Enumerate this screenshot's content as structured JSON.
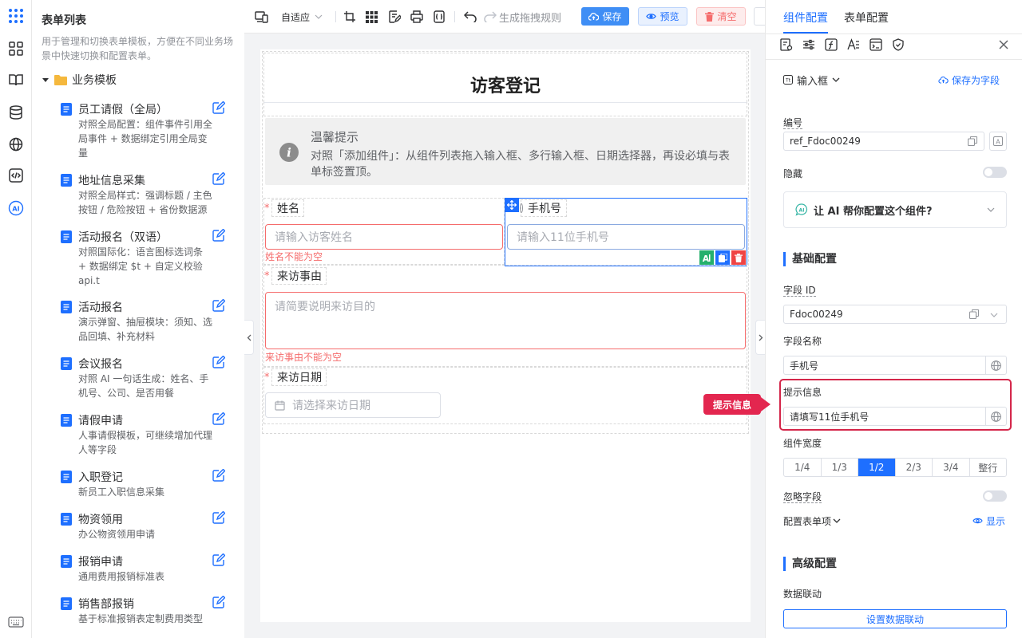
{
  "left_rail": {
    "icons": [
      "apps-grid-icon",
      "widgets-icon",
      "book-icon",
      "database-icon",
      "globe-icon",
      "code-icon",
      "ai-icon",
      "keyboard-icon"
    ]
  },
  "form_list": {
    "title": "表单列表",
    "description": "用于管理和切换表单模板，方便在不同业务场景中快速切换和配置表单。",
    "group": "业务模板",
    "items": [
      {
        "name": "员工请假（全局）",
        "desc": "对照全局配置：组件事件引用全局事件 + 数据绑定引用全局变量"
      },
      {
        "name": "地址信息采集",
        "desc": "对照全局样式：强调标题 / 主色按钮 / 危险按钮 + 省份数据源"
      },
      {
        "name": "活动报名（双语）",
        "desc": "对照国际化：语言图标选词条 + 数据绑定 $t + 自定义校验 api.t"
      },
      {
        "name": "活动报名",
        "desc": "演示弹窗、抽屉模块：须知、选品回填、补充材料"
      },
      {
        "name": "会议报名",
        "desc": "对照 AI 一句话生成：姓名、手机号、公司、是否用餐"
      },
      {
        "name": "请假申请",
        "desc": "人事请假模板，可继续增加代理人等字段"
      },
      {
        "name": "入职登记",
        "desc": "新员工入职信息采集"
      },
      {
        "name": "物资领用",
        "desc": "办公物资领用申请"
      },
      {
        "name": "报销申请",
        "desc": "通用费用报销标准表"
      },
      {
        "name": "销售部报销",
        "desc": "基于标准报销表定制费用类型"
      }
    ]
  },
  "toolbar": {
    "layout_select": "自适应",
    "redo_rules": "生成拖拽规则",
    "save": "保存",
    "preview": "预览",
    "clear": "清空"
  },
  "form": {
    "title": "访客登记",
    "tip_title": "温馨提示",
    "tip_text": "对照「添加组件」：从组件列表拖入输入框、多行输入框、日期选择器，再设必填与表单标签置顶。",
    "fields": [
      {
        "label": "姓名",
        "placeholder": "请输入访客姓名",
        "error": "姓名不能为空"
      },
      {
        "label": "手机号",
        "placeholder": "请输入11位手机号"
      },
      {
        "label": "来访事由",
        "placeholder": "请简要说明来访目的",
        "error": "来访事由不能为空"
      },
      {
        "label": "来访日期",
        "placeholder": "请选择来访日期"
      }
    ],
    "required_mark": "*",
    "field_tools": [
      "ai-icon",
      "copy-icon",
      "delete-icon"
    ]
  },
  "panel": {
    "tabs": [
      "组件配置",
      "表单配置"
    ],
    "component_type": "输入框",
    "save_as_field": "保存为字段",
    "number_label": "编号",
    "number_value": "ref_Fdoc00249",
    "hidden_label": "隐藏",
    "ai_prompt": "让 AI 帮你配置这个组件?",
    "basic_section": "基础配置",
    "field_id_label": "字段 ID",
    "field_id_value": "Fdoc00249",
    "field_name_label": "字段名称",
    "field_name_value": "手机号",
    "hint_label": "提示信息",
    "hint_value": "请填写11位手机号",
    "callout": "提示信息",
    "width_label": "组件宽度",
    "width_options": [
      "1/4",
      "1/3",
      "1/2",
      "2/3",
      "3/4",
      "整行"
    ],
    "width_selected": "1/2",
    "ignore_label": "忽略字段",
    "config_items_label": "配置表单项",
    "show_label": "显示",
    "advanced_section": "高级配置",
    "linkage_label": "数据联动",
    "linkage_button": "设置数据联动"
  },
  "colors": {
    "primary": "#1e6fff",
    "danger": "#f56c6c",
    "highlight": "#d4264a",
    "callout": "#e3264f"
  }
}
